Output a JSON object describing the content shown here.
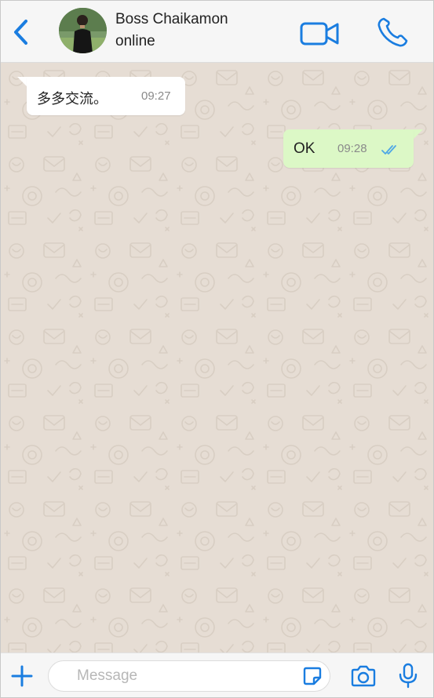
{
  "header": {
    "contact_name": "Boss Chaikamon",
    "status": "online",
    "accent_color": "#1a7de0",
    "icons": {
      "back": "chevron-left-icon",
      "video": "video-camera-icon",
      "call": "phone-icon"
    }
  },
  "chat": {
    "wallpaper_color": "#e6ddd4",
    "messages": [
      {
        "direction": "incoming",
        "text": "多多交流。",
        "time": "09:27"
      },
      {
        "direction": "outgoing",
        "text": "OK",
        "time": "09:28",
        "read_receipt": "double-check-icon"
      }
    ]
  },
  "composer": {
    "placeholder": "Message",
    "value": "",
    "icons": {
      "attach": "plus-icon",
      "sticker": "sticker-icon",
      "camera": "camera-icon",
      "mic": "microphone-icon"
    }
  }
}
